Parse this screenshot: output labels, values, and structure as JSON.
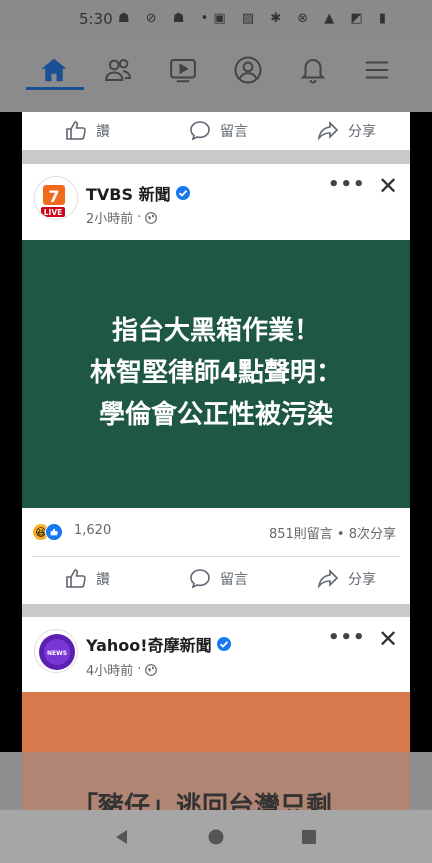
{
  "status_bar": {
    "time": "5:30",
    "left_icons": "☗ ⊘ ☗ •",
    "right_icons": "▣ ▨ ✱ ⊗ ▲ ◩ ▮"
  },
  "nav": {
    "items": [
      "home-icon",
      "friends-icon",
      "watch-icon",
      "profile-icon",
      "notifications-icon",
      "menu-icon"
    ],
    "active": "home-icon",
    "accent": "#1a4f96"
  },
  "actions": {
    "like": "讚",
    "comment": "留言",
    "share": "分享"
  },
  "post1": {
    "page_name": "TVBS 新聞",
    "time": "2小時前",
    "more": "•••",
    "close": "✕",
    "headline_lines": [
      "指台大黑箱作業！",
      "林智堅律師4點聲明：",
      "學倫會公正性被污染"
    ],
    "reaction_count": "1,620",
    "comments_shares": "851則留言 • 8次分享",
    "headline_bg": "#1e5745"
  },
  "post2": {
    "page_name": "Yahoo!奇摩新聞",
    "time": "4小時前",
    "more": "•••",
    "close": "✕",
    "partial_headline": "「豬仔」逃回台灣只剩",
    "image_bg": "#d97a4e"
  }
}
